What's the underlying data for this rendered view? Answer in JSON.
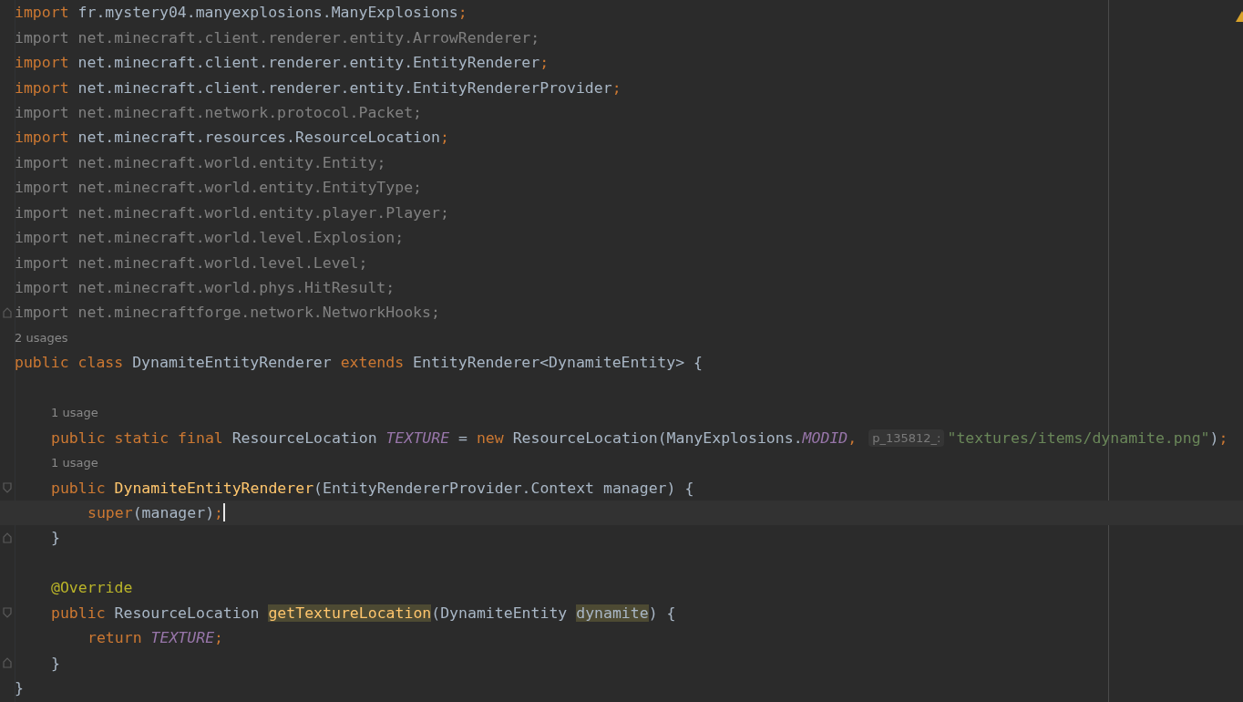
{
  "editor": {
    "warning": true,
    "lines": [
      {
        "kind": "code",
        "unused": false,
        "tokens": [
          {
            "kind": "keyword",
            "text": "import"
          },
          {
            "kind": "plain",
            "text": " fr.mystery04.manyexplosions.ManyExplosions"
          },
          {
            "kind": "keyword",
            "text": ";"
          }
        ]
      },
      {
        "kind": "code",
        "unused": true,
        "tokens": [
          {
            "kind": "keyword",
            "text": "import"
          },
          {
            "kind": "plain",
            "text": " net.minecraft.client.renderer.entity.ArrowRenderer"
          },
          {
            "kind": "keyword",
            "text": ";"
          }
        ]
      },
      {
        "kind": "code",
        "unused": false,
        "tokens": [
          {
            "kind": "keyword",
            "text": "import"
          },
          {
            "kind": "plain",
            "text": " net.minecraft.client.renderer.entity.EntityRenderer"
          },
          {
            "kind": "keyword",
            "text": ";"
          }
        ]
      },
      {
        "kind": "code",
        "unused": false,
        "tokens": [
          {
            "kind": "keyword",
            "text": "import"
          },
          {
            "kind": "plain",
            "text": " net.minecraft.client.renderer.entity.EntityRendererProvider"
          },
          {
            "kind": "keyword",
            "text": ";"
          }
        ]
      },
      {
        "kind": "code",
        "unused": true,
        "tokens": [
          {
            "kind": "keyword",
            "text": "import"
          },
          {
            "kind": "plain",
            "text": " net.minecraft.network.protocol.Packet"
          },
          {
            "kind": "keyword",
            "text": ";"
          }
        ]
      },
      {
        "kind": "code",
        "unused": false,
        "tokens": [
          {
            "kind": "keyword",
            "text": "import"
          },
          {
            "kind": "plain",
            "text": " net.minecraft.resources.ResourceLocation"
          },
          {
            "kind": "keyword",
            "text": ";"
          }
        ]
      },
      {
        "kind": "code",
        "unused": true,
        "tokens": [
          {
            "kind": "keyword",
            "text": "import"
          },
          {
            "kind": "plain",
            "text": " net.minecraft.world.entity.Entity"
          },
          {
            "kind": "keyword",
            "text": ";"
          }
        ]
      },
      {
        "kind": "code",
        "unused": true,
        "tokens": [
          {
            "kind": "keyword",
            "text": "import"
          },
          {
            "kind": "plain",
            "text": " net.minecraft.world.entity.EntityType"
          },
          {
            "kind": "keyword",
            "text": ";"
          }
        ]
      },
      {
        "kind": "code",
        "unused": true,
        "tokens": [
          {
            "kind": "keyword",
            "text": "import"
          },
          {
            "kind": "plain",
            "text": " net.minecraft.world.entity.player.Player"
          },
          {
            "kind": "keyword",
            "text": ";"
          }
        ]
      },
      {
        "kind": "code",
        "unused": true,
        "tokens": [
          {
            "kind": "keyword",
            "text": "import"
          },
          {
            "kind": "plain",
            "text": " net.minecraft.world.level.Explosion"
          },
          {
            "kind": "keyword",
            "text": ";"
          }
        ]
      },
      {
        "kind": "code",
        "unused": true,
        "tokens": [
          {
            "kind": "keyword",
            "text": "import"
          },
          {
            "kind": "plain",
            "text": " net.minecraft.world.level.Level"
          },
          {
            "kind": "keyword",
            "text": ";"
          }
        ]
      },
      {
        "kind": "code",
        "unused": true,
        "tokens": [
          {
            "kind": "keyword",
            "text": "import"
          },
          {
            "kind": "plain",
            "text": " net.minecraft.world.phys.HitResult"
          },
          {
            "kind": "keyword",
            "text": ";"
          }
        ]
      },
      {
        "kind": "code",
        "unused": true,
        "fold_end": true,
        "tokens": [
          {
            "kind": "keyword",
            "text": "import"
          },
          {
            "kind": "plain",
            "text": " net.minecraftforge.network.NetworkHooks"
          },
          {
            "kind": "keyword",
            "text": ";"
          }
        ]
      },
      {
        "kind": "usage",
        "text": "2 usages"
      },
      {
        "kind": "code",
        "unused": false,
        "tokens": [
          {
            "kind": "keyword",
            "text": "public class "
          },
          {
            "kind": "plain",
            "text": "DynamiteEntityRenderer "
          },
          {
            "kind": "keyword",
            "text": "extends "
          },
          {
            "kind": "plain",
            "text": "EntityRenderer<DynamiteEntity> {"
          }
        ],
        "children": [
          {
            "kind": "blank"
          },
          {
            "kind": "usage",
            "text": "1 usage"
          },
          {
            "kind": "code",
            "unused": false,
            "tokens": [
              {
                "kind": "keyword",
                "text": "public static final "
              },
              {
                "kind": "plain",
                "text": "ResourceLocation "
              },
              {
                "kind": "constant",
                "text": "TEXTURE"
              },
              {
                "kind": "plain",
                "text": " = "
              },
              {
                "kind": "keyword",
                "text": "new "
              },
              {
                "kind": "plain",
                "text": "ResourceLocation(ManyExplosions."
              },
              {
                "kind": "constant",
                "text": "MODID"
              },
              {
                "kind": "keyword",
                "text": ","
              },
              {
                "kind": "hint",
                "text": "p_135812_:"
              },
              {
                "kind": "string",
                "text": "\"textures/items/dynamite.png\""
              },
              {
                "kind": "plain",
                "text": ")"
              },
              {
                "kind": "keyword",
                "text": ";"
              }
            ]
          },
          {
            "kind": "usage",
            "text": "1 usage"
          },
          {
            "kind": "code",
            "unused": false,
            "fold_start": true,
            "tokens": [
              {
                "kind": "keyword",
                "text": "public "
              },
              {
                "kind": "function",
                "text": "DynamiteEntityRenderer"
              },
              {
                "kind": "plain",
                "text": "(EntityRendererProvider.Context manager) {"
              }
            ],
            "children": [
              {
                "kind": "code",
                "unused": false,
                "current": true,
                "caret": true,
                "tokens": [
                  {
                    "kind": "keyword",
                    "text": "super"
                  },
                  {
                    "kind": "plain",
                    "text": "(manager)"
                  },
                  {
                    "kind": "keyword",
                    "text": ";"
                  }
                ]
              }
            ]
          },
          {
            "kind": "code",
            "unused": false,
            "fold_end": true,
            "tokens": [
              {
                "kind": "plain",
                "text": "}"
              }
            ]
          },
          {
            "kind": "blank"
          },
          {
            "kind": "code",
            "unused": false,
            "tokens": [
              {
                "kind": "annotation",
                "text": "@Override"
              }
            ]
          },
          {
            "kind": "code",
            "unused": false,
            "fold_start": true,
            "tokens": [
              {
                "kind": "keyword",
                "text": "public ",
                "highlighted": false
              },
              {
                "kind": "plain",
                "text": "ResourceLocation ",
                "highlighted": false
              },
              {
                "kind": "function",
                "text": "getTextureLocation",
                "highlighted": true
              },
              {
                "kind": "plain",
                "text": "(DynamiteEntity ",
                "highlighted": false
              },
              {
                "kind": "plain",
                "text": "dynamite",
                "highlighted": true
              },
              {
                "kind": "plain",
                "text": ") {",
                "highlighted": false
              }
            ],
            "children": [
              {
                "kind": "code",
                "unused": false,
                "tokens": [
                  {
                    "kind": "keyword",
                    "text": "return "
                  },
                  {
                    "kind": "constant",
                    "text": "TEXTURE"
                  },
                  {
                    "kind": "keyword",
                    "text": ";"
                  }
                ]
              }
            ]
          },
          {
            "kind": "code",
            "unused": false,
            "fold_end": true,
            "tokens": [
              {
                "kind": "plain",
                "text": "}"
              }
            ]
          }
        ]
      },
      {
        "kind": "code",
        "unused": false,
        "tokens": [
          {
            "kind": "plain",
            "text": "}"
          }
        ]
      }
    ]
  }
}
